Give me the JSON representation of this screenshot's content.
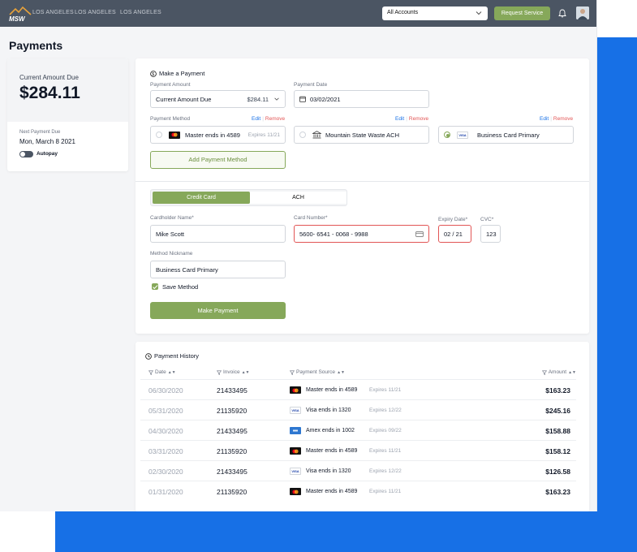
{
  "header": {
    "nav": [
      "LOS ANGELES",
      "LOS ANGELES",
      "LOS ANGELES"
    ],
    "account_select": "All Accounts",
    "request_button": "Request Service"
  },
  "page": {
    "title": "Payments"
  },
  "due": {
    "label": "Current Amount Due",
    "amount": "$284.11",
    "next_label": "Next Payment Due",
    "next_date": "Mon, March 8 2021",
    "autopay_label": "Autopay"
  },
  "payment": {
    "title": "Make a Payment",
    "amount_label": "Payment Amount",
    "amount_option": "Current Amount Due",
    "amount_value": "$284.11",
    "date_label": "Payment Date",
    "date_value": "03/02/2021",
    "method_label": "Payment Method",
    "edit": "Edit",
    "remove": "Remove",
    "methods": [
      {
        "name": "Master ends in 4589",
        "expires": "Expires 11/21"
      },
      {
        "name": "Mountain State Waste ACH",
        "expires": ""
      },
      {
        "name": "Business Card Primary",
        "expires": ""
      }
    ],
    "add_method": "Add Payment Method",
    "tabs": [
      "Credit Card",
      "ACH"
    ],
    "cardholder_label": "Cardholder Name*",
    "cardholder_value": "Mike Scott",
    "card_number_label": "Card Number*",
    "card_number_value": "5600- 6541 - 0068 - 9988",
    "expiry_label": "Expiry Date*",
    "expiry_value": "02 / 21",
    "cvc_label": "CVC*",
    "cvc_value": "123",
    "nickname_label": "Method Nickname",
    "nickname_value": "Business Card Primary",
    "save_method": "Save Method",
    "submit": "Make Payment"
  },
  "history": {
    "title": "Payment History",
    "columns": [
      "Date",
      "Invoice",
      "Payment Source",
      "Amount"
    ],
    "rows": [
      {
        "date": "06/30/2020",
        "invoice": "21433495",
        "card": "mastercard",
        "source": "Master ends in 4589",
        "expires": "Expires 11/21",
        "amount": "$163.23"
      },
      {
        "date": "05/31/2020",
        "invoice": "21135920",
        "card": "visa",
        "source": "Visa ends in 1320",
        "expires": "Expires 12/22",
        "amount": "$245.16"
      },
      {
        "date": "04/30/2020",
        "invoice": "21433495",
        "card": "amex",
        "source": "Amex ends in 1002",
        "expires": "Expires 09/22",
        "amount": "$158.88"
      },
      {
        "date": "03/31/2020",
        "invoice": "21135920",
        "card": "mastercard",
        "source": "Master ends in 4589",
        "expires": "Expires 11/21",
        "amount": "$158.12"
      },
      {
        "date": "02/30/2020",
        "invoice": "21433495",
        "card": "visa",
        "source": "Visa ends in 1320",
        "expires": "Expires 12/22",
        "amount": "$126.58"
      },
      {
        "date": "01/31/2020",
        "invoice": "21135920",
        "card": "mastercard",
        "source": "Master ends in 4589",
        "expires": "Expires 11/21",
        "amount": "$163.23"
      }
    ]
  },
  "colors": {
    "accent_green": "#86a85a",
    "brand_blue": "#1770e6",
    "topbar": "#4b5563",
    "error_red": "#e25555"
  }
}
